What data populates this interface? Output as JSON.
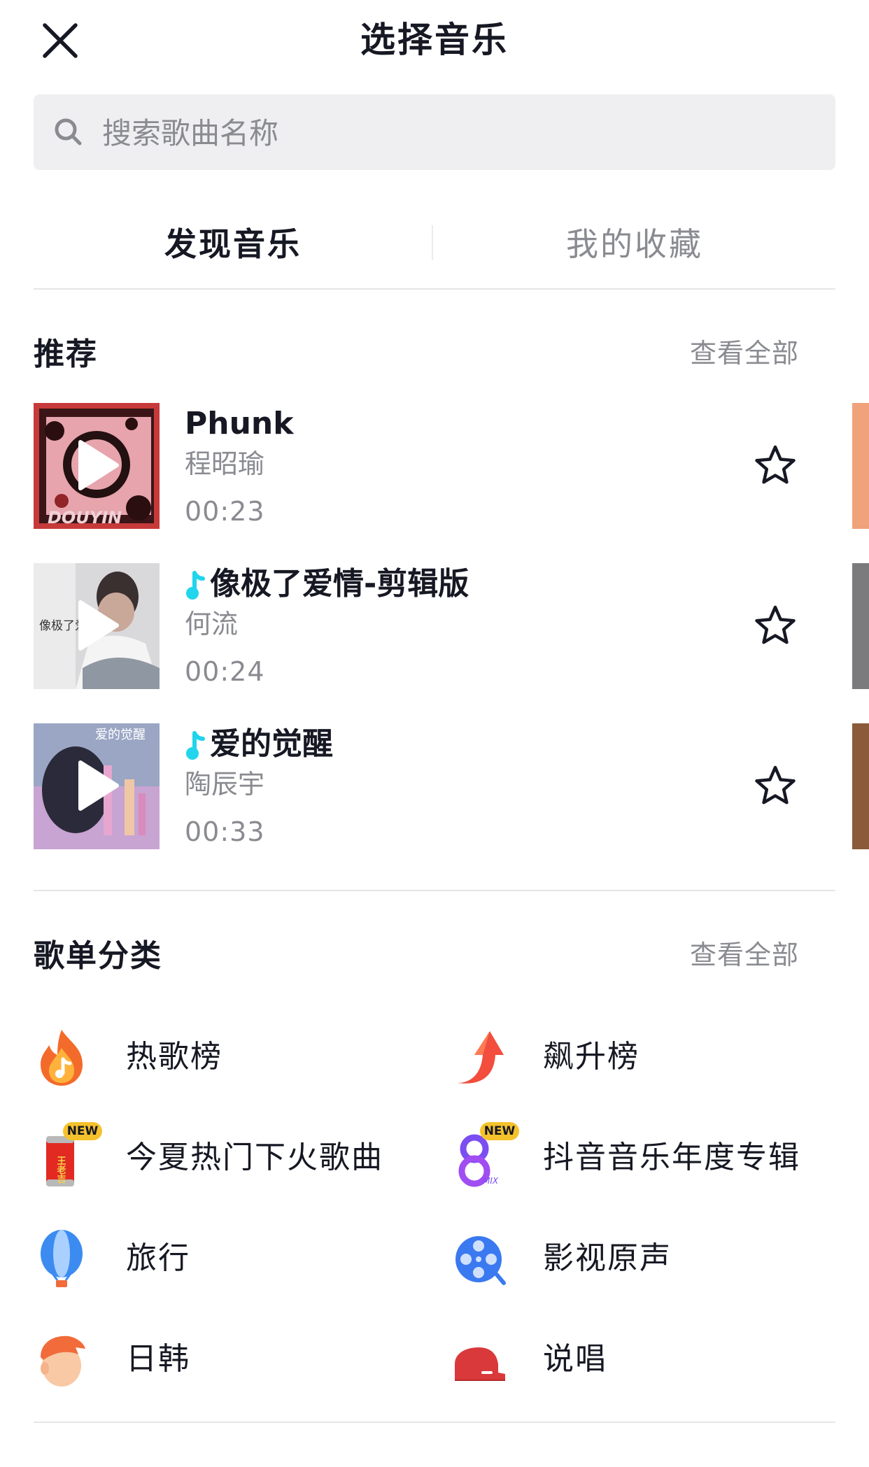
{
  "header": {
    "title": "选择音乐",
    "close_icon": "close-icon"
  },
  "search": {
    "placeholder": "搜索歌曲名称",
    "icon": "search-icon"
  },
  "tabs": [
    {
      "label": "发现音乐",
      "active": true
    },
    {
      "label": "我的收藏",
      "active": false
    }
  ],
  "recommend": {
    "title": "推荐",
    "see_all": "查看全部",
    "songs": [
      {
        "name": "Phunk",
        "artist": "程昭瑜",
        "duration": "00:23",
        "has_note": false,
        "cover_text": "DOUYIN"
      },
      {
        "name": "像极了爱情-剪辑版",
        "artist": "何流",
        "duration": "00:24",
        "has_note": true,
        "cover_text": "像极了爱情"
      },
      {
        "name": "爱的觉醒",
        "artist": "陶辰宇",
        "duration": "00:33",
        "has_note": true,
        "cover_text": "爱的觉醒"
      }
    ]
  },
  "playlists": {
    "title": "歌单分类",
    "see_all": "查看全部",
    "items": [
      {
        "label": "热歌榜",
        "icon": "flame-music-icon"
      },
      {
        "label": "飙升榜",
        "icon": "rising-arrow-icon"
      },
      {
        "label": "今夏热门下火歌曲",
        "icon": "drink-can-icon",
        "badge": "NEW",
        "can_text": "王老吉"
      },
      {
        "label": "抖音音乐年度专辑",
        "icon": "mix-album-icon",
        "badge": "NEW",
        "mix_text": "MIX"
      },
      {
        "label": "旅行",
        "icon": "hot-air-balloon-icon"
      },
      {
        "label": "影视原声",
        "icon": "film-reel-icon"
      },
      {
        "label": "日韩",
        "icon": "cartoon-face-icon"
      },
      {
        "label": "说唱",
        "icon": "cap-icon"
      }
    ]
  },
  "colors": {
    "accent_note": "#20d5ec",
    "text_primary": "#161823",
    "text_secondary": "#8a8b91",
    "search_bg": "#efeff1"
  }
}
